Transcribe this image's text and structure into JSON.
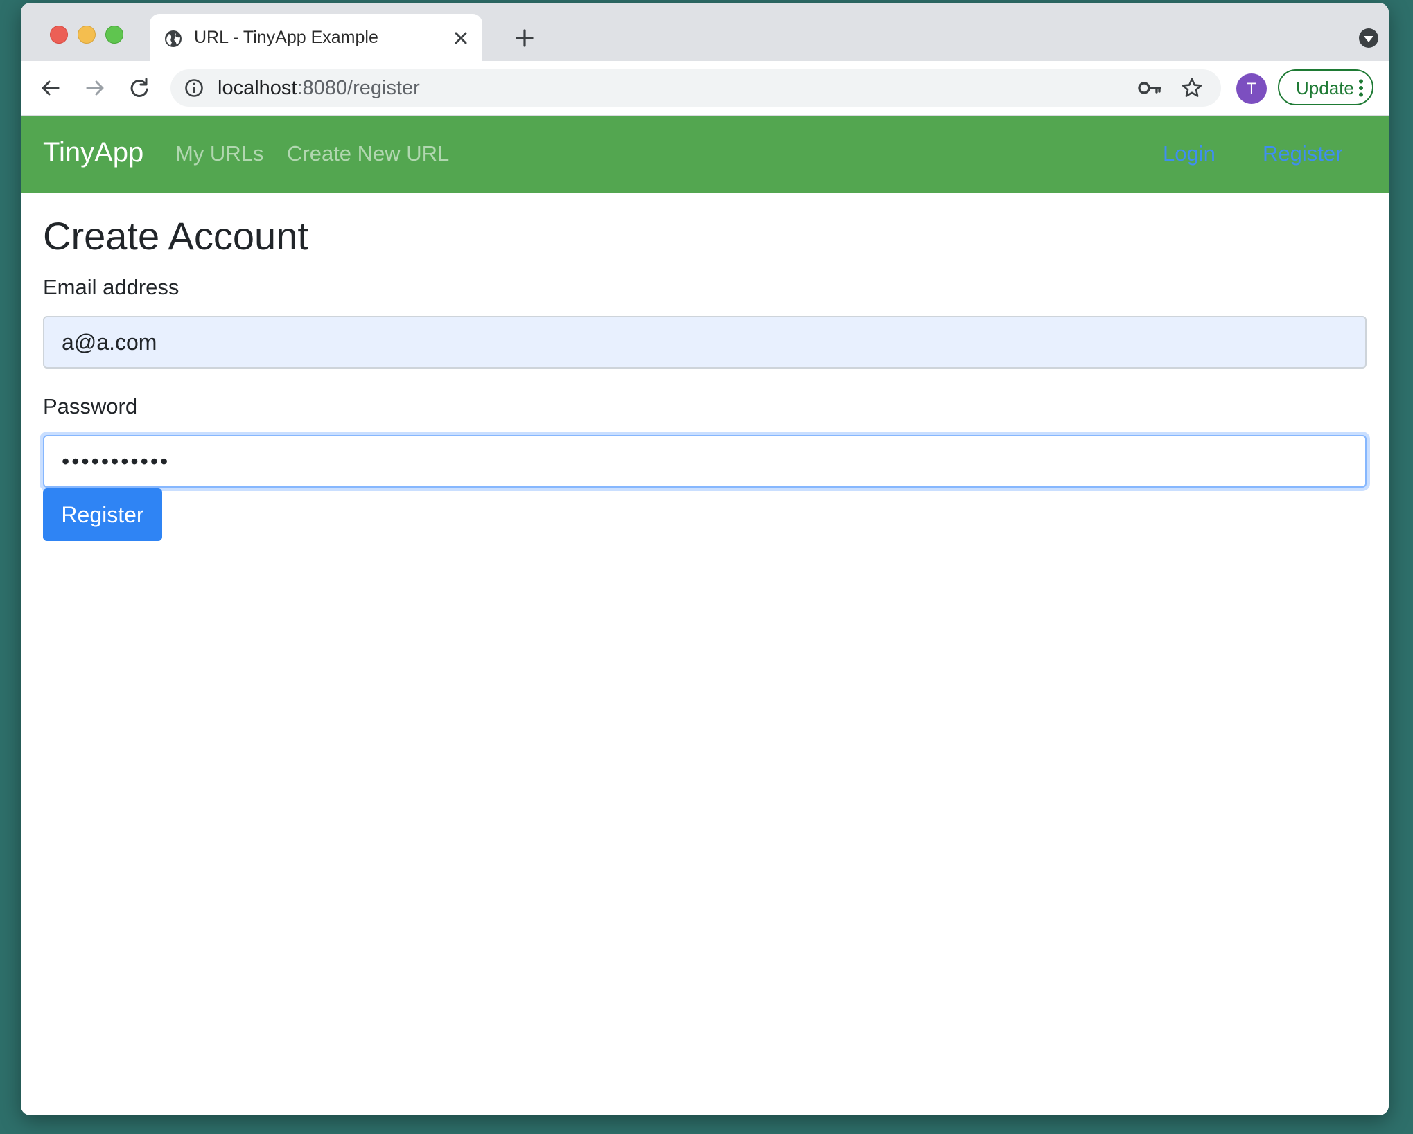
{
  "browser": {
    "tab": {
      "title": "URL - TinyApp Example"
    },
    "address": {
      "host": "localhost",
      "path": ":8080/register"
    },
    "profile_initial": "T",
    "update_label": "Update",
    "icons": [
      "globe-icon",
      "close-icon",
      "plus-icon",
      "tab-search-icon",
      "back-arrow-icon",
      "forward-arrow-icon",
      "reload-icon",
      "info-icon",
      "key-icon",
      "star-icon",
      "kebab-menu-icon"
    ]
  },
  "navbar": {
    "brand": "TinyApp",
    "links": {
      "my_urls": "My URLs",
      "create_new_url": "Create New URL",
      "login": "Login",
      "register": "Register"
    },
    "color": "#53a650"
  },
  "form": {
    "heading": "Create Account",
    "email_label": "Email address",
    "email_value": "a@a.com",
    "password_label": "Password",
    "password_value": "12345678901",
    "submit_label": "Register",
    "submit_color": "#2f84f4"
  }
}
